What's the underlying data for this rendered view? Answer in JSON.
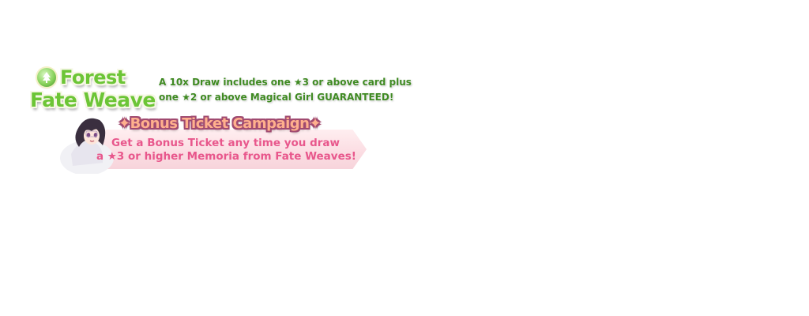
{
  "banner": {
    "title_line1": "Forest",
    "title_line2": "Fate Weave",
    "description_line1": "A 10x Draw includes one ★3 or above card plus",
    "description_line2": "one ★2 or above Magical Girl GUARANTEED!",
    "campaign_title": "✦Bonus Ticket Campaign✦",
    "campaign_line1": "Get a Bonus Ticket any time you draw",
    "campaign_line2": "a ★3 or higher Memoria from Fate Weaves!",
    "icon": "forest-attribute-icon",
    "colors": {
      "title_green": "#6cc536",
      "description_green": "#3f8a22",
      "campaign_pink": "#e8578c",
      "campaign_title_orange": "#ffb08d"
    }
  }
}
